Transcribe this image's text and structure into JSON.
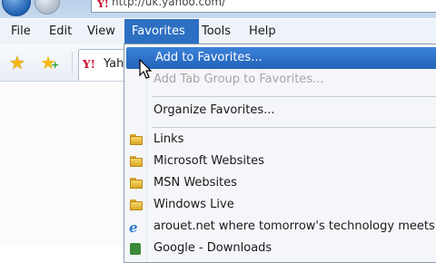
{
  "address_bar": {
    "url": "http://uk.yahoo.com/",
    "favicon": "Y!"
  },
  "menubar": {
    "items": [
      {
        "label": "File",
        "active": false
      },
      {
        "label": "Edit",
        "active": false
      },
      {
        "label": "View",
        "active": false
      },
      {
        "label": "Favorites",
        "active": true
      },
      {
        "label": "Tools",
        "active": false
      },
      {
        "label": "Help",
        "active": false
      }
    ]
  },
  "favbar": {
    "tab_label": "Yah",
    "tab_favicon": "Y!"
  },
  "favorites_menu": {
    "add_to_favorites": "Add to Favorites...",
    "add_tab_group": "Add Tab Group to Favorites...",
    "organize": "Organize Favorites...",
    "folders": [
      "Links",
      "Microsoft Websites",
      "MSN Websites",
      "Windows Live"
    ],
    "links": [
      {
        "label": "arouet.net  where tomorrow's technology meets y",
        "icon": "ie-icon"
      },
      {
        "label": "Google - Downloads",
        "icon": "page-icon"
      }
    ]
  },
  "colors": {
    "highlight": "#2d6fc2",
    "menubar_bg": "#eef3fa",
    "folder": "#f0c94a"
  }
}
